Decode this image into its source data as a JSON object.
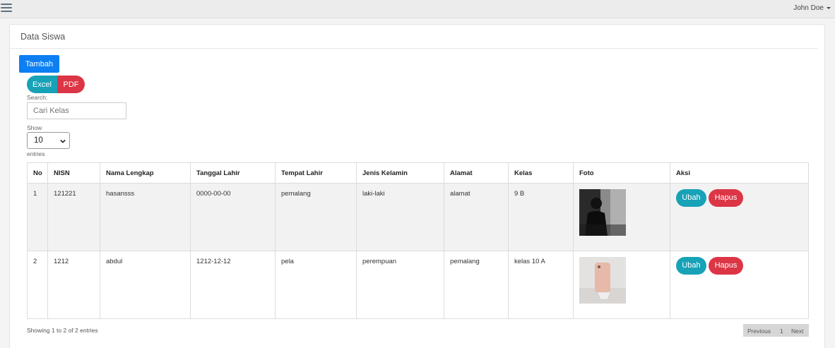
{
  "topbar": {
    "user_name": "John Doe"
  },
  "panel": {
    "title": "Data Siswa"
  },
  "actions": {
    "add_label": "Tambah",
    "excel_label": "Excel",
    "pdf_label": "PDF"
  },
  "search": {
    "label": "Search:",
    "placeholder": "Cari Kelas"
  },
  "length": {
    "show_label": "Show",
    "value": "10",
    "entries_label": "entries"
  },
  "table": {
    "headers": [
      "No",
      "NISN",
      "Nama Lengkap",
      "Tanggal Lahir",
      "Tempat Lahir",
      "Jenis Kelamin",
      "Alamat",
      "Kelas",
      "Foto",
      "Aksi"
    ],
    "rows": [
      {
        "no": "1",
        "nisn": "121221",
        "nama": "hasansss",
        "tanggal": "0000-00-00",
        "tempat": "pemalang",
        "jenis": "laki-laki",
        "alamat": "alamat",
        "kelas": "9 B"
      },
      {
        "no": "2",
        "nisn": "1212",
        "nama": "abdul",
        "tanggal": "1212-12-12",
        "tempat": "pela",
        "jenis": "perempuan",
        "alamat": "pemalang",
        "kelas": "kelas 10 A"
      }
    ],
    "edit_label": "Ubah",
    "delete_label": "Hapus"
  },
  "footer": {
    "info": "Showing 1 to 2 of 2 entries",
    "prev_label": "Previous",
    "page": "1",
    "next_label": "Next"
  },
  "colors": {
    "primary": "#0d7ff2",
    "info": "#17a2b8",
    "danger": "#dc3545"
  }
}
